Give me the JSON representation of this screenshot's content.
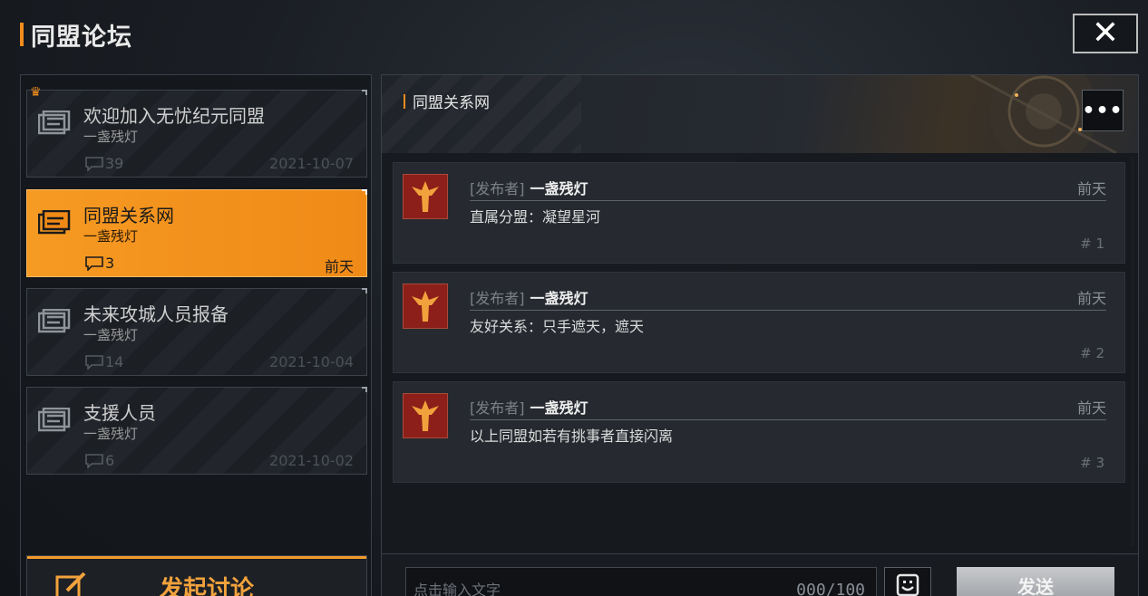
{
  "app": {
    "title": "同盟论坛",
    "close_label": "✕"
  },
  "topics": [
    {
      "title": "欢迎加入无忧纪元同盟",
      "author": "一盏残灯",
      "comments": "39",
      "date": "2021-10-07",
      "active": false,
      "pinned": true
    },
    {
      "title": "同盟关系网",
      "author": "一盏残灯",
      "comments": "3",
      "date": "前天",
      "active": true,
      "pinned": false
    },
    {
      "title": "未来攻城人员报备",
      "author": "一盏残灯",
      "comments": "14",
      "date": "2021-10-04",
      "active": false,
      "pinned": false
    },
    {
      "title": "支援人员",
      "author": "一盏残灯",
      "comments": "6",
      "date": "2021-10-02",
      "active": false,
      "pinned": false
    }
  ],
  "start_discussion": {
    "label": "发起讨论"
  },
  "thread": {
    "title": "同盟关系网",
    "more_label": "•••",
    "posts": [
      {
        "role": "[发布者]",
        "author": "一盏残灯",
        "time": "前天",
        "content": "直属分盟：凝望星河",
        "floor": "# 1"
      },
      {
        "role": "[发布者]",
        "author": "一盏残灯",
        "time": "前天",
        "content": "友好关系：只手遮天，遮天",
        "floor": "# 2"
      },
      {
        "role": "[发布者]",
        "author": "一盏残灯",
        "time": "前天",
        "content": "以上同盟如若有挑事者直接闪离",
        "floor": "# 3"
      }
    ]
  },
  "composer": {
    "placeholder": "点击输入文字",
    "counter": "000/100",
    "send_label": "发送"
  },
  "colors": {
    "accent": "#f28c1e",
    "panel": "#262a30",
    "avatar_bg": "#8c1f1a"
  }
}
